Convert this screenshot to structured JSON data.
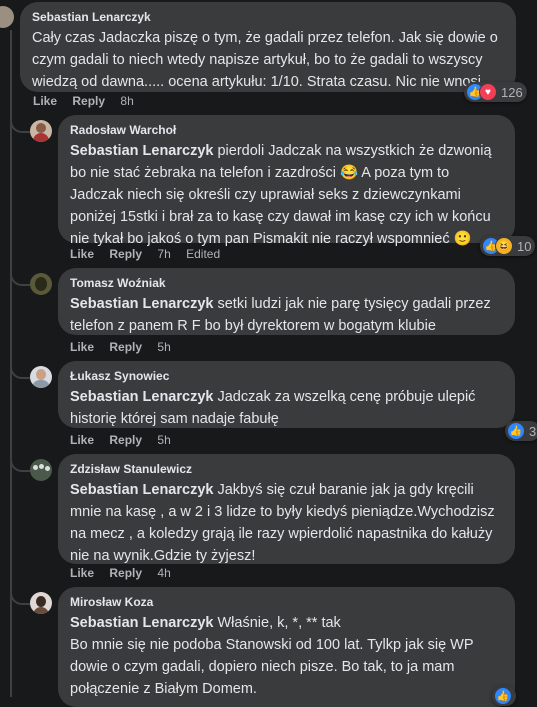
{
  "comments": [
    {
      "author": "Sebastian Lenarczyk",
      "text": "Cały czas Jadaczka piszę o tym, że gadali przez telefon. Jak się dowie o czym gadali to niech wtedy napisze artykuł, bo to że gadali to wszyscy wiedzą od dawna..... ocena artykułu: 1/10. Strata czasu. Nic nie wnosi.",
      "like": "Like",
      "reply": "Reply",
      "time": "8h",
      "reactions": "126"
    },
    {
      "author": "Radosław Warchoł",
      "mention": "Sebastian Lenarczyk",
      "text": " pierdoli Jadczak na wszystkich że dzwonią bo nie stać żebraka na telefon i zazdrości 😂 A poza tym to Jadczak niech się określi czy uprawiał seks z dziewczynkami poniżej 15stki i brał za to kasę czy dawał im kasę czy ich w końcu nie tykał bo jakoś o tym pan Pismakit nie raczył wspomnieć 🙂",
      "like": "Like",
      "reply": "Reply",
      "time": "7h",
      "edited": "Edited",
      "reactions": "10"
    },
    {
      "author": "Tomasz Woźniak",
      "mention": "Sebastian Lenarczyk",
      "text": " setki ludzi jak nie parę tysięcy gadali przez telefon z panem R F bo był dyrektorem w bogatym klubie",
      "like": "Like",
      "reply": "Reply",
      "time": "5h"
    },
    {
      "author": "Łukasz Synowiec",
      "mention": "Sebastian Lenarczyk",
      "text": " Jadczak za wszelką cenę próbuje ulepić historię której sam nadaje fabułę",
      "like": "Like",
      "reply": "Reply",
      "time": "5h",
      "reactions": "3"
    },
    {
      "author": "Zdzisław Stanulewicz",
      "mention": "Sebastian Lenarczyk",
      "text": " Jakbyś się czuł baranie jak ja gdy kręcili mnie na kasę , a w 2 i 3 lidze to były kiedyś pieniądze.Wychodzisz na mecz , a koledzy grają ile razy wpierdolić napastnika do kałuży nie na wynik.Gdzie ty żyjesz!",
      "like": "Like",
      "reply": "Reply",
      "time": "4h"
    },
    {
      "author": "Mirosław Koza",
      "mention": "Sebastian Lenarczyk",
      "text": " Właśnie, k, *, ** tak",
      "text2": "Bo mnie się nie podoba Stanowski od 100 lat. Tylkp jak się WP dowie o czym gadali, dopiero niech pisze. Bo tak, to ja mam połączenie z Białym Domem."
    }
  ]
}
